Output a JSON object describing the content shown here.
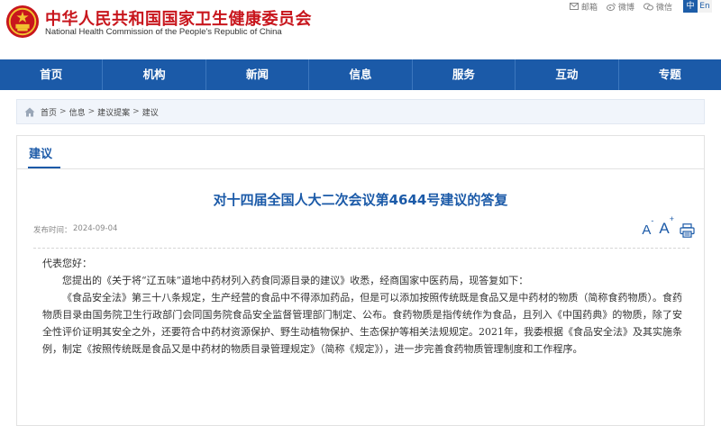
{
  "header": {
    "title": "中华人民共和国国家卫生健康委员会",
    "subtitle": "National Health Commission of the People's Republic of China",
    "links": [
      {
        "label": "邮箱",
        "icon": "mail-icon"
      },
      {
        "label": "微博",
        "icon": "weibo-icon"
      },
      {
        "label": "微信",
        "icon": "wechat-icon"
      }
    ],
    "lang_zh": "中",
    "lang_en": "En"
  },
  "nav": {
    "items": [
      "首页",
      "机构",
      "新闻",
      "信息",
      "服务",
      "互动",
      "专题"
    ]
  },
  "breadcrumb": {
    "items": [
      "首页",
      "信息",
      "建议提案",
      "建议"
    ],
    "separator": ">"
  },
  "tab": {
    "label": "建议"
  },
  "article": {
    "title": "对十四届全国人大二次会议第4644号建议的答复",
    "date_label": "发布时间：",
    "date": "2024-09-04",
    "font_small": "A",
    "font_big": "A",
    "font_minus": "-",
    "font_plus": "+",
    "paragraphs": [
      "代表您好：",
      "您提出的《关于将“辽五味”道地中药材列入药食同源目录的建议》收悉，经商国家中医药局，现答复如下：",
      "《食品安全法》第三十八条规定，生产经营的食品中不得添加药品，但是可以添加按照传统既是食品又是中药材的物质（简称食药物质）。食药物质目录由国务院卫生行政部门会同国务院食品安全监督管理部门制定、公布。食药物质是指传统作为食品，且列入《中国药典》的物质，除了安全性评价证明其安全之外，还要符合中药材资源保护、野生动植物保护、生态保护等相关法规规定。2021年，我委根据《食品安全法》及其实施条例，制定《按照传统既是食品又是中药材的物质目录管理规定》（简称《规定》），进一步完善食药物质管理制度和工作程序。"
    ]
  },
  "colors": {
    "brand_red": "#c8161d",
    "nav_blue": "#1b5aa8",
    "breadcrumb_bg": "#f1f5fb"
  }
}
